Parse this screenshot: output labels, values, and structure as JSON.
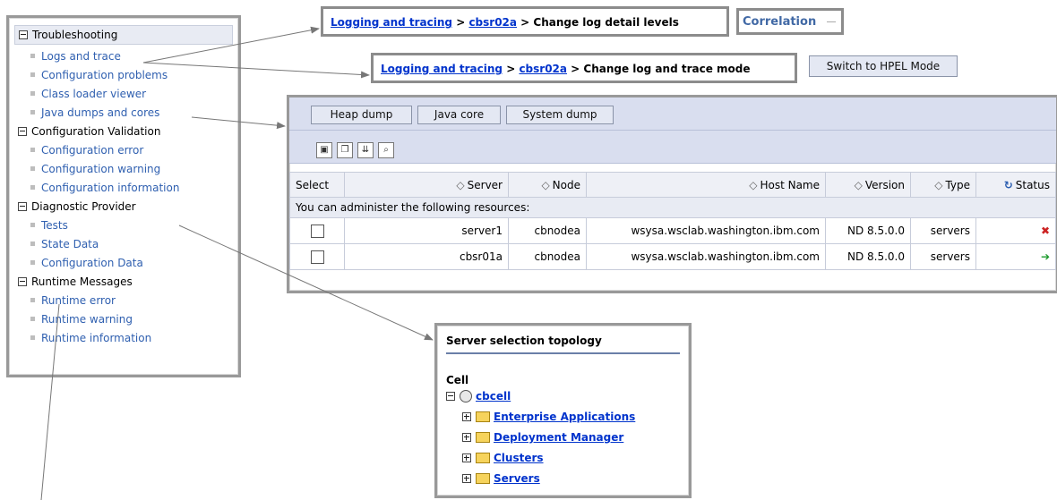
{
  "nav": {
    "header": "Troubleshooting",
    "items": [
      {
        "label": "Logs and trace"
      },
      {
        "label": "Configuration problems"
      },
      {
        "label": "Class loader viewer"
      },
      {
        "label": "Java dumps and cores"
      }
    ],
    "groups": [
      {
        "label": "Configuration Validation",
        "items": [
          "Configuration error",
          "Configuration warning",
          "Configuration information"
        ]
      },
      {
        "label": "Diagnostic Provider",
        "items": [
          "Tests",
          "State Data",
          "Configuration Data"
        ]
      },
      {
        "label": "Runtime Messages",
        "items": [
          "Runtime error",
          "Runtime warning",
          "Runtime information"
        ]
      }
    ]
  },
  "crumb1": {
    "link1": "Logging and tracing",
    "sep1": " > ",
    "link2": "cbsr02a",
    "rest": " > Change log detail levels"
  },
  "correlation_tab": "Correlation",
  "crumb2": {
    "link1": "Logging and tracing",
    "sep1": " > ",
    "link2": "cbsr02a",
    "rest": " > Change log and trace mode"
  },
  "hpel_button": "Switch to HPEL Mode",
  "servers": {
    "buttons": [
      "Heap dump",
      "Java core",
      "System dump"
    ],
    "columns": [
      "Select",
      "Server",
      "Node",
      "Host Name",
      "Version",
      "Type",
      "Status"
    ],
    "note": "You can administer the following resources:",
    "rows": [
      {
        "server": "server1",
        "node": "cbnodea",
        "host": "wsysa.wsclab.washington.ibm.com",
        "version": "ND 8.5.0.0",
        "type": "servers",
        "status": "stopped"
      },
      {
        "server": "cbsr01a",
        "node": "cbnodea",
        "host": "wsysa.wsclab.washington.ibm.com",
        "version": "ND 8.5.0.0",
        "type": "servers",
        "status": "started"
      }
    ]
  },
  "topology": {
    "title": "Server selection topology",
    "cell_label": "Cell",
    "root": "cbcell",
    "children": [
      "Enterprise Applications",
      "Deployment Manager",
      "Clusters",
      "Servers"
    ]
  },
  "colors": {
    "link": "#0033cc",
    "nav_link": "#3060b0",
    "toolbar": "#d9deef",
    "status_error": "#cc2222",
    "status_ok": "#1c9a2c"
  }
}
